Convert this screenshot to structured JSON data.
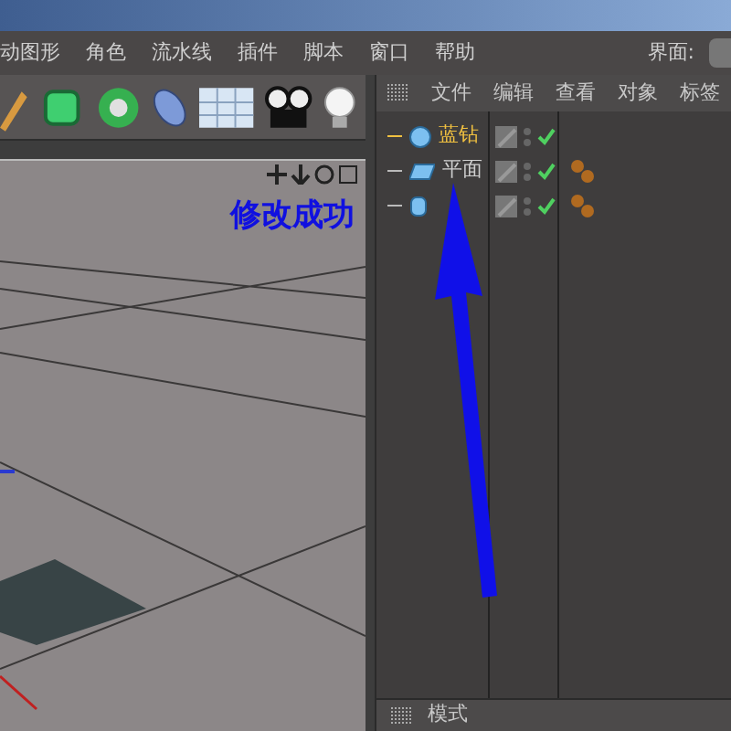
{
  "menu_bar": {
    "items": [
      "动图形",
      "角色",
      "流水线",
      "插件",
      "脚本",
      "窗口",
      "帮助"
    ],
    "layout_label": "界面:"
  },
  "viewport": {
    "annotation": "修改成功"
  },
  "object_manager": {
    "menu": [
      "文件",
      "编辑",
      "查看",
      "对象",
      "标签"
    ],
    "objects": [
      {
        "name": "蓝钻",
        "kind": "sphere",
        "selected": true,
        "enabled": true,
        "material": false
      },
      {
        "name": "平面",
        "kind": "plane",
        "selected": false,
        "enabled": true,
        "material": true
      },
      {
        "kind": "cylinder",
        "selected": false,
        "enabled": true,
        "material": true
      }
    ]
  },
  "attributes": {
    "tab": "模式"
  }
}
